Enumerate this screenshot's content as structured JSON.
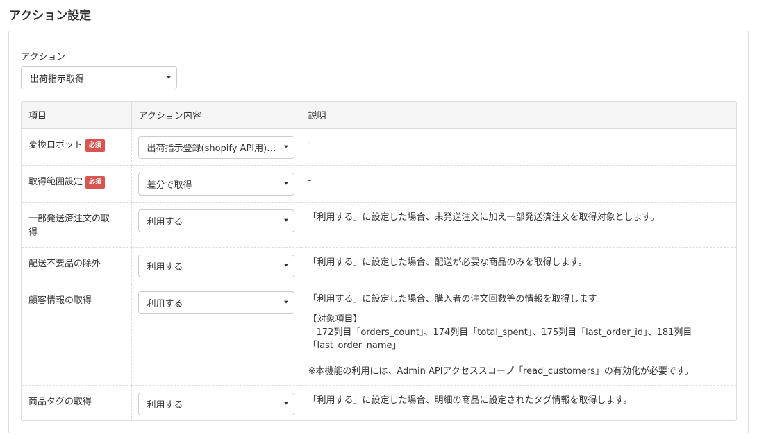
{
  "page": {
    "title": "アクション設定"
  },
  "action": {
    "label": "アクション",
    "selected": "出荷指示取得"
  },
  "table": {
    "headers": [
      "項目",
      "アクション内容",
      "説明"
    ],
    "required_badge": "必須",
    "rows": [
      {
        "item": "変換ロボット",
        "required": true,
        "value": "出荷指示登録(shopify API用) - 既定",
        "desc": [
          "-"
        ]
      },
      {
        "item": "取得範囲設定",
        "required": true,
        "value": "差分で取得",
        "desc": [
          "-"
        ]
      },
      {
        "item": "一部発送済注文の取得",
        "required": false,
        "value": "利用する",
        "desc": [
          "「利用する」に設定した場合、未発送注文に加え一部発送済注文を取得対象とします。"
        ]
      },
      {
        "item": "配送不要品の除外",
        "required": false,
        "value": "利用する",
        "desc": [
          "「利用する」に設定した場合、配送が必要な商品のみを取得します。"
        ]
      },
      {
        "item": "顧客情報の取得",
        "required": false,
        "value": "利用する",
        "desc": [
          "「利用する」に設定した場合、購入者の注文回数等の情報を取得します。"
        ],
        "detail_title": "【対象項目】",
        "detail_lines": [
          "172列目「orders_count」、174列目「total_spent」、175列目「last_order_id」、181列目",
          "「last_order_name」"
        ],
        "note": "※本機能の利用には、Admin APIアクセススコープ「read_customers」の有効化が必要です。"
      },
      {
        "item": "商品タグの取得",
        "required": false,
        "value": "利用する",
        "desc": [
          "「利用する」に設定した場合、明細の商品に設定されたタグ情報を取得します。"
        ]
      }
    ]
  },
  "icons": {
    "dropdown": "caret-down-icon"
  },
  "colors": {
    "required_badge": "#d9534f",
    "header_bg": "#f5f5f5",
    "border": "#dddddd"
  }
}
